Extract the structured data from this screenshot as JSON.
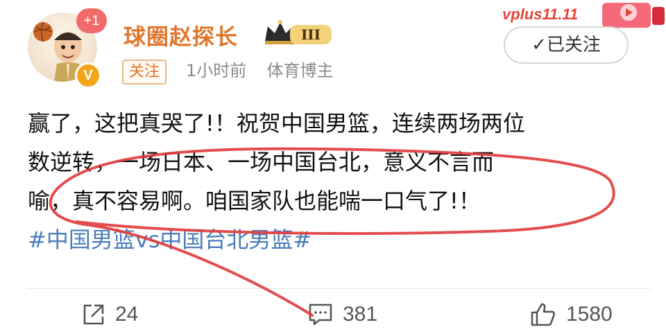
{
  "post": {
    "author": {
      "name": "球圈赵探长",
      "avatar_badge": "+1",
      "verified_badge": "V",
      "level": "III"
    },
    "follow_tag": "关注",
    "time": "1小时前",
    "role": "体育博主",
    "followed_button": "✓已关注",
    "promo_text": "vplus11.11",
    "content_lines": [
      "赢了，这把真哭了!！祝贺中国男篮，连续两场两位",
      "数逆转，一场日本、一场中国台北，意义不言而",
      "喻，真不容易啊。咱国家队也能喘一口气了!！"
    ],
    "hashtag": "#中国男篮vs中国台北男篮#",
    "actions": {
      "share_count": "24",
      "comment_count": "381",
      "like_count": "1580"
    }
  },
  "colors": {
    "username": "#e0762b",
    "hashtag": "#4a7dbb",
    "annotation": "#e03a3a"
  }
}
